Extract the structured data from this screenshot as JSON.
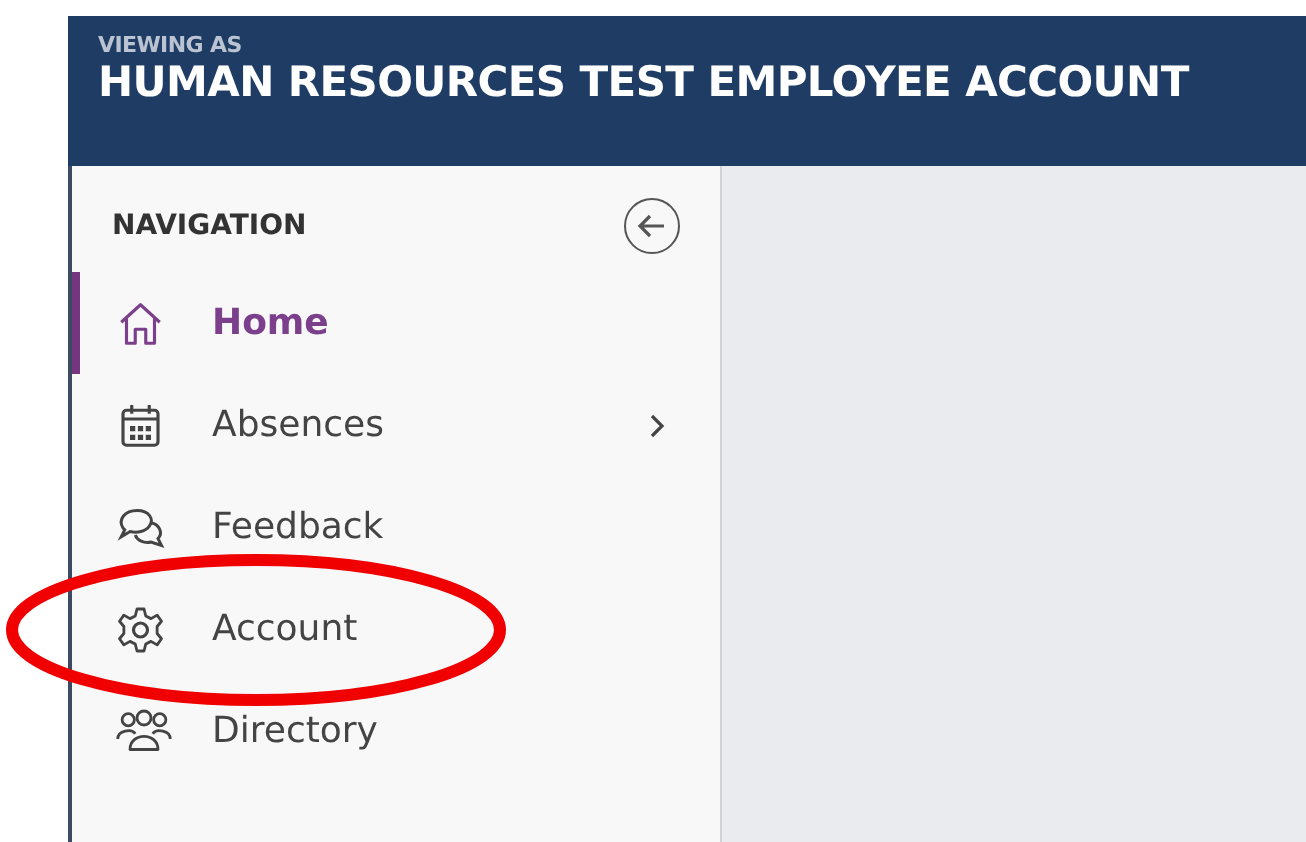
{
  "header": {
    "caption": "VIEWING AS",
    "title": "HUMAN RESOURCES TEST EMPLOYEE ACCOUNT"
  },
  "sidebar": {
    "heading": "NAVIGATION",
    "items": [
      {
        "label": "Home",
        "selected": true,
        "expandable": false,
        "circled": false
      },
      {
        "label": "Absences",
        "selected": false,
        "expandable": true,
        "circled": false
      },
      {
        "label": "Feedback",
        "selected": false,
        "expandable": false,
        "circled": false
      },
      {
        "label": "Account",
        "selected": false,
        "expandable": false,
        "circled": true
      },
      {
        "label": "Directory",
        "selected": false,
        "expandable": false,
        "circled": false
      }
    ]
  }
}
